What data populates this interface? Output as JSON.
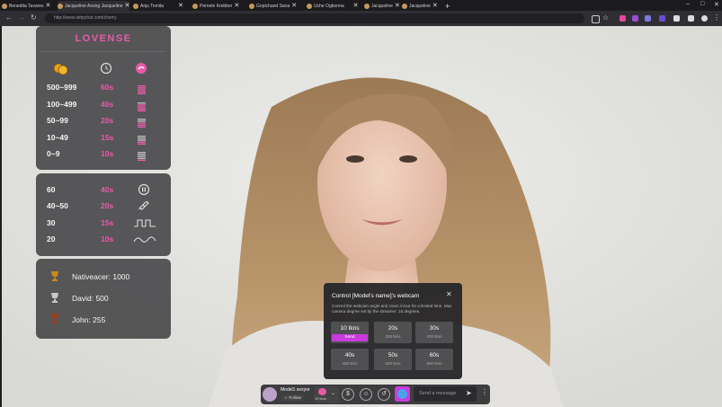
{
  "tabs": [
    {
      "label": "Benedita Tavares"
    },
    {
      "label": "Jacqueline Asong Jacqueline"
    },
    {
      "label": "Anju Tomita"
    },
    {
      "label": "Pernele Krebber"
    },
    {
      "label": "Gopichand Sana"
    },
    {
      "label": "Uche Ogbonna"
    },
    {
      "label": "Jacqueline"
    },
    {
      "label": "Jacqueline"
    }
  ],
  "address_bar": {
    "url": "http://www.stripchat.com/cherry"
  },
  "lovense": {
    "logo": "LOVENSE",
    "levels": [
      {
        "range": "500~999",
        "time": "60s"
      },
      {
        "range": "100~499",
        "time": "40s"
      },
      {
        "range": "50~99",
        "time": "20s"
      },
      {
        "range": "10~49",
        "time": "15s"
      },
      {
        "range": "0~9",
        "time": "10s"
      }
    ],
    "patterns": [
      {
        "amount": "60",
        "time": "40s",
        "icon": "pause-icon"
      },
      {
        "amount": "40~50",
        "time": "20s",
        "icon": "rotate-icon"
      },
      {
        "amount": "30",
        "time": "15s",
        "icon": "pulse-icon"
      },
      {
        "amount": "20",
        "time": "10s",
        "icon": "wave-icon"
      }
    ],
    "leaders": [
      {
        "text": "Nativeacer: 1000",
        "color": "#c98a1a"
      },
      {
        "text": "David: 500",
        "color": "#c9c9c9"
      },
      {
        "text": "John: 255",
        "color": "#9b3d22"
      }
    ]
  },
  "popup": {
    "title": "Control [Model's name]'s webcam",
    "description": "Control the webcam angle and zoom in/out for a limited time. Max camera degree set by the streamer: 15 degrees.",
    "options": [
      {
        "time": "10 tkns",
        "sub": "Send"
      },
      {
        "time": "20s",
        "sub": "200 tkns"
      },
      {
        "time": "30s",
        "sub": "300 tkns"
      },
      {
        "time": "40s",
        "sub": "400 tkns"
      },
      {
        "time": "50s",
        "sub": "500 tkns"
      },
      {
        "time": "60s",
        "sub": "600 tkns"
      }
    ]
  },
  "bottom": {
    "model_name": "Model1 sexyor",
    "follow": "Follow",
    "tokens": "15 tkns",
    "message_placeholder": "Send a message"
  },
  "colors": {
    "accent": "#e85ba8",
    "send_button": "#c93bdc"
  }
}
